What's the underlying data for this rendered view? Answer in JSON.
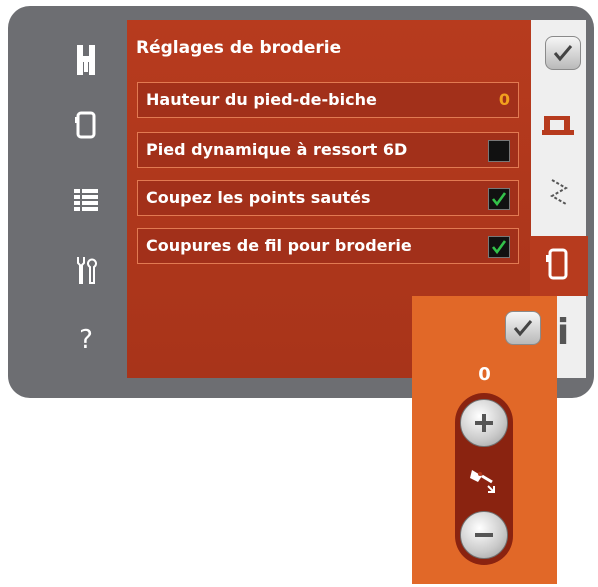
{
  "panel": {
    "title": "Réglages de broderie",
    "rows": [
      {
        "label": "Hauteur du pied-de-biche",
        "value": "0"
      },
      {
        "label": "Pied dynamique à ressort 6D",
        "checked": false
      },
      {
        "label": "Coupez les points sautés",
        "checked": true
      },
      {
        "label": "Coupures de fil pour broderie",
        "checked": true
      }
    ]
  },
  "sidebar": {
    "help_label": "?",
    "icons": [
      "presser-foot-icon",
      "hoop-icon",
      "list-icon",
      "tools-icon",
      "help-icon"
    ]
  },
  "right_tabs": {
    "icons": [
      "confirm-check-icon",
      "sewing-machine-icon",
      "stitch-icon",
      "hoop-tab-icon",
      "info-icon"
    ],
    "info_label": "i"
  },
  "popup": {
    "value": "0",
    "icons": [
      "confirm-check-icon",
      "plus-icon",
      "presser-foot-height-icon",
      "minus-icon"
    ]
  },
  "colors": {
    "panel": "#b73b1e",
    "row_border": "#e27a52",
    "popup": "#e16828",
    "value_text": "#f2a01e",
    "check_green": "#33c24a",
    "device_gray": "#6d6e72"
  }
}
